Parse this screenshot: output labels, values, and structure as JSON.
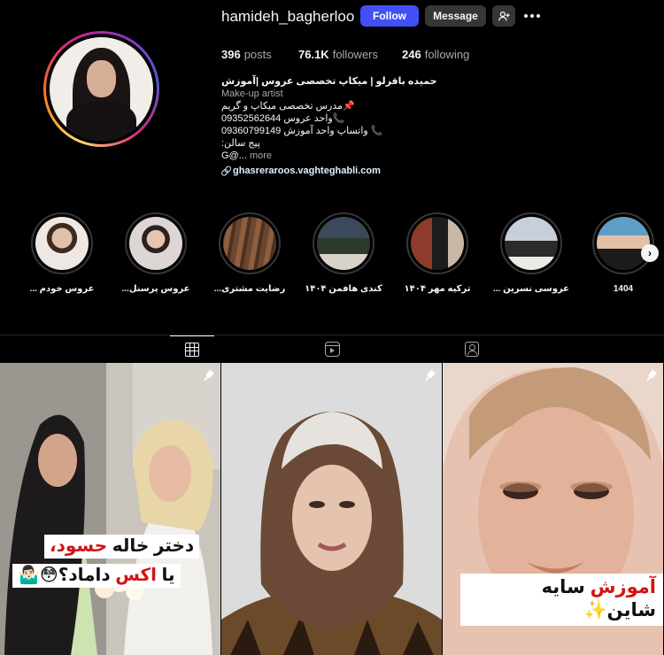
{
  "profile": {
    "username": "hamideh_bagherloo",
    "follow_label": "Follow",
    "message_label": "Message",
    "add_user_icon": "person-add-icon",
    "more_icon": "more-horizontal-icon",
    "stats": {
      "posts_count": "396",
      "posts_label": "posts",
      "followers_count": "76.1K",
      "followers_label": "followers",
      "following_count": "246",
      "following_label": "following"
    },
    "bio": {
      "name": "حمیده باقرلو | میکاپ تخصصی عروس |آموزش",
      "category": "Make-up artist",
      "lines": [
        "📌مدرس تخصصی میکاپ و گریم",
        "📞واحد عروس 09352562644",
        "📞 واتساپ واحد آموزش 09360799149",
        "پیج سالن:",
        "G@..."
      ],
      "more_label": "more",
      "link": "ghasreraroos.vaghteghabli.com"
    }
  },
  "highlights": [
    {
      "label": "عروس خودم ..."
    },
    {
      "label": "عروس پرسنل..."
    },
    {
      "label": "رضایت مشتری..."
    },
    {
      "label": "کندی هافمن ۱۴۰۴"
    },
    {
      "label": "ترکیه مهر ۱۴۰۴"
    },
    {
      "label": "عروسی نسرین ..."
    },
    {
      "label": "1404"
    }
  ],
  "tabs": [
    {
      "name": "posts",
      "icon": "grid-icon",
      "active": true
    },
    {
      "name": "reels",
      "icon": "reels-icon",
      "active": false
    },
    {
      "name": "tagged",
      "icon": "tagged-icon",
      "active": false
    }
  ],
  "posts": [
    {
      "pinned": true,
      "caption_line1_a": "دختر خاله ",
      "caption_line1_b": "حسود،",
      "caption_line2_a": "یا ",
      "caption_line2_b": "اکس",
      "caption_line2_c": " داماد؟😳🤷🏻‍♂️"
    },
    {
      "pinned": true
    },
    {
      "pinned": true,
      "caption_a": "آموزش",
      "caption_b": " سایه شاین✨"
    }
  ],
  "colors": {
    "background": "#000000",
    "follow_button": "#4150f7",
    "secondary_button": "#363636",
    "muted_text": "#a8a8a8",
    "caption_red": "#d11414"
  }
}
